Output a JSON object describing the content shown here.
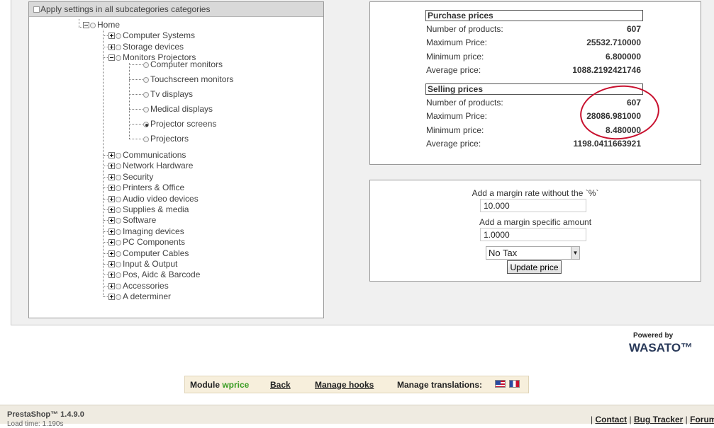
{
  "tree": {
    "apply_label": "Apply settings in all subcategories categories",
    "root": "Home",
    "before": [
      "Computer Systems",
      "Storage devices"
    ],
    "open": "Monitors Projectors",
    "children": [
      "Computer monitors",
      "Touchscreen monitors",
      "Tv displays",
      "Medical displays",
      "Projector screens",
      "Projectors"
    ],
    "selected": "Projector screens",
    "after": [
      "Communications",
      "Network Hardware",
      "Security",
      "Printers & Office",
      "Audio video devices",
      "Supplies & media",
      "Software",
      "Imaging devices",
      "PC Components",
      "Computer Cables",
      "Input & Output",
      "Pos, Aidc & Barcode",
      "Accessories",
      "A determiner"
    ]
  },
  "purchase": {
    "title": "Purchase prices",
    "rows": [
      {
        "label": "Number of products:",
        "value": "607"
      },
      {
        "label": "Maximum Price:",
        "value": "25532.710000"
      },
      {
        "label": "Minimum price:",
        "value": "6.800000"
      },
      {
        "label": "Average price:",
        "value": "1088.2192421746"
      }
    ]
  },
  "selling": {
    "title": "Selling prices",
    "rows": [
      {
        "label": "Number of products:",
        "value": "607"
      },
      {
        "label": "Maximum Price:",
        "value": "28086.981000"
      },
      {
        "label": "Minimum price:",
        "value": "8.480000"
      },
      {
        "label": "Average price:",
        "value": "1198.0411663921"
      }
    ]
  },
  "margin": {
    "rate_label": "Add a margin rate without the `%`",
    "rate_value": "10.000",
    "amount_label": "Add a margin specific amount",
    "amount_value": "1.0000",
    "tax_option": "No Tax",
    "button": "Update price"
  },
  "brand": {
    "powered": "Powered by",
    "name": "WASATO™"
  },
  "footer": {
    "module_prefix": "Module",
    "module_name": "wprice",
    "back": "Back",
    "hooks": "Manage hooks",
    "translations": "Manage translations:"
  },
  "bottom": {
    "version": "PrestaShop™ 1.4.9.0",
    "loadtime": "Load time: 1.190s",
    "sep": "|",
    "links": [
      "Contact",
      "Bug Tracker",
      "Forum"
    ]
  },
  "colors": {
    "accent_circle": "#c8102e",
    "module_green": "#3a9d23",
    "footer_bg": "#f7efdc"
  }
}
